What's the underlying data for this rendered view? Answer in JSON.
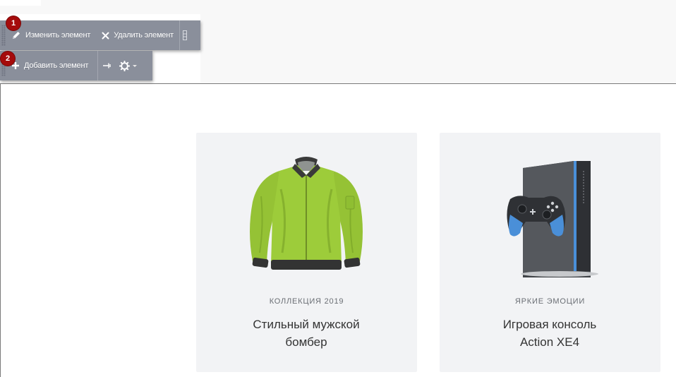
{
  "toolbar_edit": {
    "edit_label": "Изменить элемент",
    "delete_label": "Удалить элемент",
    "badge": "1"
  },
  "toolbar_add": {
    "add_label": "Добавить элемент",
    "badge": "2"
  },
  "icons": [
    "pencil-icon",
    "close-icon",
    "plus-icon",
    "pin-icon",
    "gear-icon",
    "chevron-down-icon",
    "drag-handle-icon"
  ],
  "products": [
    {
      "category": "КОЛЛЕКЦИЯ 2019",
      "title_line1": "Стильный мужской",
      "title_line2": "бомбер",
      "image": "green bomber jacket"
    },
    {
      "category": "ЯРКИЕ ЭМОЦИИ",
      "title_line1": "Игровая консоль",
      "title_line2": "Action XE4",
      "image": "game console with gamepad"
    }
  ],
  "colors": {
    "toolbar_bg": "#8a8f9b",
    "badge": "#a50b0b",
    "card_bg": "#f2f3f5",
    "jacket": "#9dcc3a",
    "console_accent": "#4a8fd8"
  }
}
